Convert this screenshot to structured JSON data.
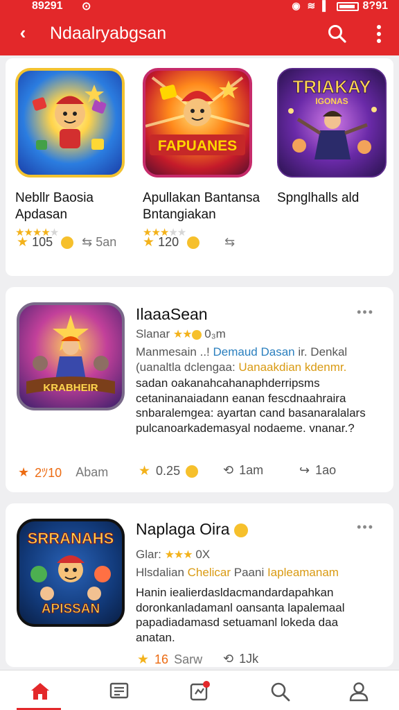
{
  "status_bar": {
    "time": "89291",
    "battery_text": "8?91"
  },
  "app_bar": {
    "title": "Ndaalryabgsan"
  },
  "featured": [
    {
      "title": "Nebllr Baosia\nApdasan",
      "rating": 4,
      "stars": "★★★★",
      "likes": "105",
      "shares": "5an"
    },
    {
      "title": "Apullakan Bantansa\nBntangiakan",
      "rating": 3.5,
      "stars": "★★★",
      "likes": "120",
      "shares": ""
    },
    {
      "title": "Spnglhalls ald",
      "rating": 0,
      "stars": "",
      "likes": "",
      "shares": ""
    }
  ],
  "icons": {
    "feat_0_text": "",
    "feat_1_text": "FAPUANES",
    "feat_2_text": "TRIAKAY",
    "feat_2_sub": "IGONAS",
    "post_0_text": "KRABHEIR",
    "post_1_text": "SRRANAHS",
    "post_1_sub": "APISSAN"
  },
  "posts": [
    {
      "title": "IlaaaSean",
      "meta_prefix": "Slanar",
      "meta_suffix": "0₃m",
      "tagline_a": "Manmesain ..! ",
      "tagline_b": "Demaud Dasan",
      "tagline_c": " ir. Denkal",
      "tagline2_a": "(uanaltla dclengaa: ",
      "tagline2_b": "Uanaakdian kdenmr.",
      "body": "sadan oakanahcahanaphderripsms cetaninanaiadann eanan fescdnaahraira snbaralemgea: ayartan cand basanaralalars pulcanoarkademasyal nodaeme. vnanar.?",
      "rating": "2ﾂ10",
      "rating_suffix": "Abam",
      "likes": "0.25",
      "comments": "1am",
      "shares": "1ao"
    },
    {
      "title": "Naplaga Oira",
      "meta_prefix": "Glar:",
      "meta_suffix": "0X",
      "tagline_a": "Hlsdalian ",
      "tagline_b": "Chelicar",
      "tagline_c": " Paani ",
      "tagline_d": "Iapleamanam",
      "body": "Hanin iealierdasldacmandardapahkan doronkanladamanl oansanta lapalemaal papadiadamasd setuamanl lokeda daa anatan.",
      "rating": "16",
      "rating_suffix": "Sarw",
      "comments": "1Jk"
    }
  ],
  "bottom_nav": [
    "home",
    "feed",
    "activity",
    "search",
    "profile"
  ],
  "colors": {
    "brand": "#e3282a",
    "star": "#f3b21b",
    "link": "#2a7fbe",
    "accent": "#d99a12"
  }
}
